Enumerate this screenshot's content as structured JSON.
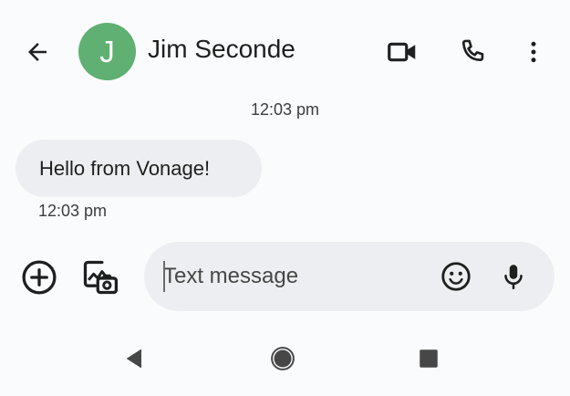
{
  "header": {
    "back_icon": "arrow-back-icon",
    "avatar_initial": "J",
    "avatar_color": "#5fb072",
    "contact_name": "Jim Seconde",
    "video_icon": "video-call-icon",
    "call_icon": "phone-icon",
    "more_icon": "more-vert-icon"
  },
  "conversation": {
    "timestamp_header": "12:03 pm",
    "messages": [
      {
        "text": "Hello from Vonage!",
        "time": "12:03 pm",
        "direction": "incoming"
      }
    ]
  },
  "composer": {
    "add_icon": "add-circle-icon",
    "gallery_icon": "gallery-camera-icon",
    "placeholder": "Text message",
    "value": "",
    "emoji_icon": "emoji-icon",
    "mic_icon": "mic-icon"
  },
  "navigation": {
    "back_icon": "nav-back-icon",
    "home_icon": "nav-home-icon",
    "recents_icon": "nav-recents-icon"
  }
}
